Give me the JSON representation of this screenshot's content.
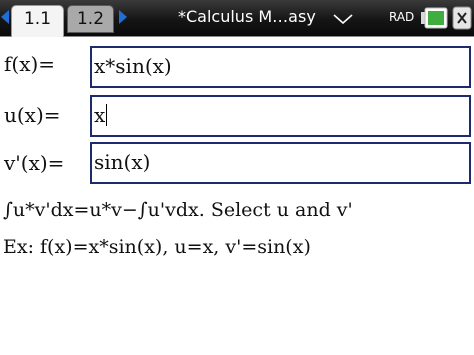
{
  "topbar": {
    "tabs": [
      {
        "label": "1.1",
        "active": true
      },
      {
        "label": "1.2",
        "active": false
      }
    ],
    "document_title": "*Calculus M…asy",
    "angle_mode": "RAD",
    "icons": [
      "arrow-left-icon",
      "arrow-right-icon",
      "dropdown-icon",
      "battery-icon",
      "close-icon"
    ],
    "accent_color": "#1f6fd6"
  },
  "form": {
    "fields": [
      {
        "label": "f(x)=",
        "value": "x*sin(x)"
      },
      {
        "label": "u(x)=",
        "value": "x"
      },
      {
        "label": "v'(x)=",
        "value": "sin(x)"
      }
    ],
    "field_border_color": "#1d2a6b"
  },
  "instructions": "∫u*v'dx=u*v−∫u'vdx. Select u and v'",
  "example": "Ex: f(x)=x*sin(x), u=x, v'=sin(x)"
}
